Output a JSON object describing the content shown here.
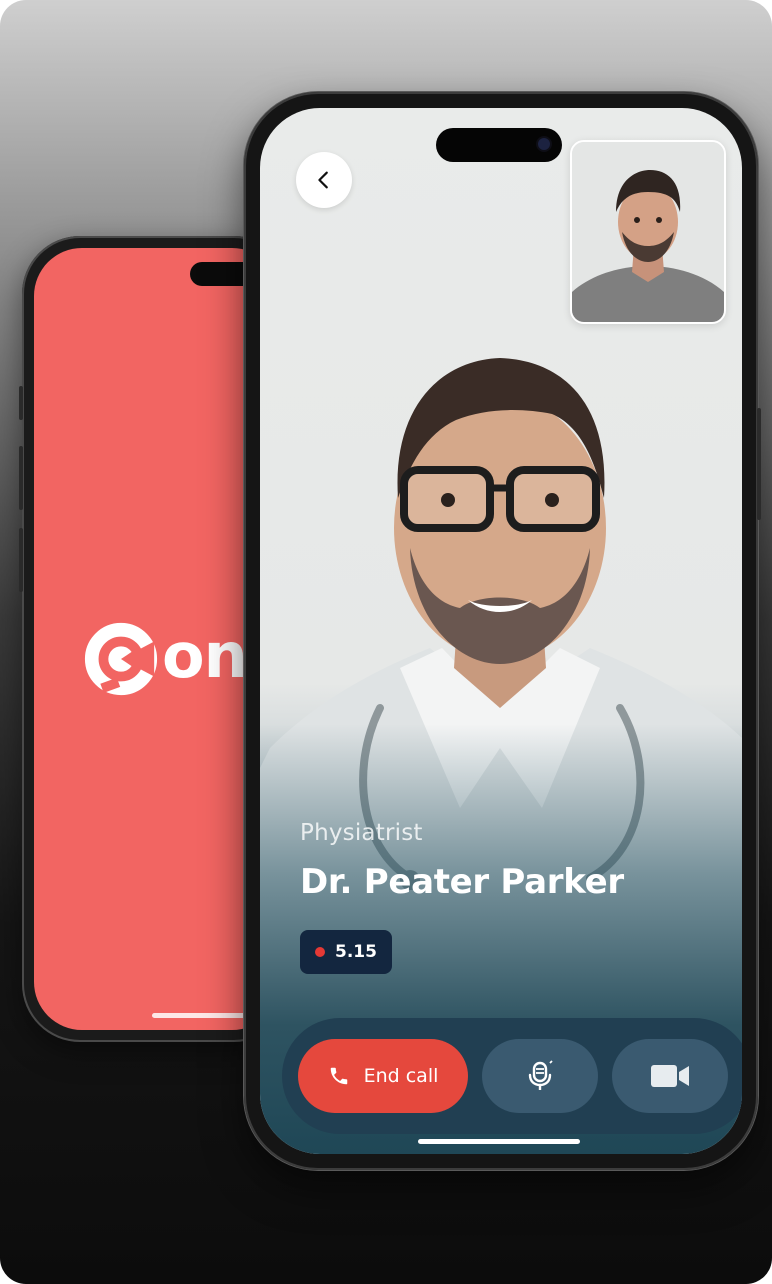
{
  "splash": {
    "brand_text": "on",
    "background_color": "#f26562",
    "logo_icon": "c-logo-icon"
  },
  "call": {
    "back_icon": "chevron-left-icon",
    "doctor_specialty": "Physiatrist",
    "doctor_name": "Dr. Peater Parker",
    "call_duration": "5.15",
    "recording_indicator_color": "#e53935",
    "controls": {
      "end_call_label": "End call",
      "end_call_icon": "phone-icon",
      "end_call_color": "#e5483d",
      "mic_icon": "microphone-icon",
      "video_icon": "video-camera-icon"
    }
  },
  "colors": {
    "accent": "#f26562",
    "panel": "#213f52",
    "screen_bottom": "#1f4756"
  }
}
